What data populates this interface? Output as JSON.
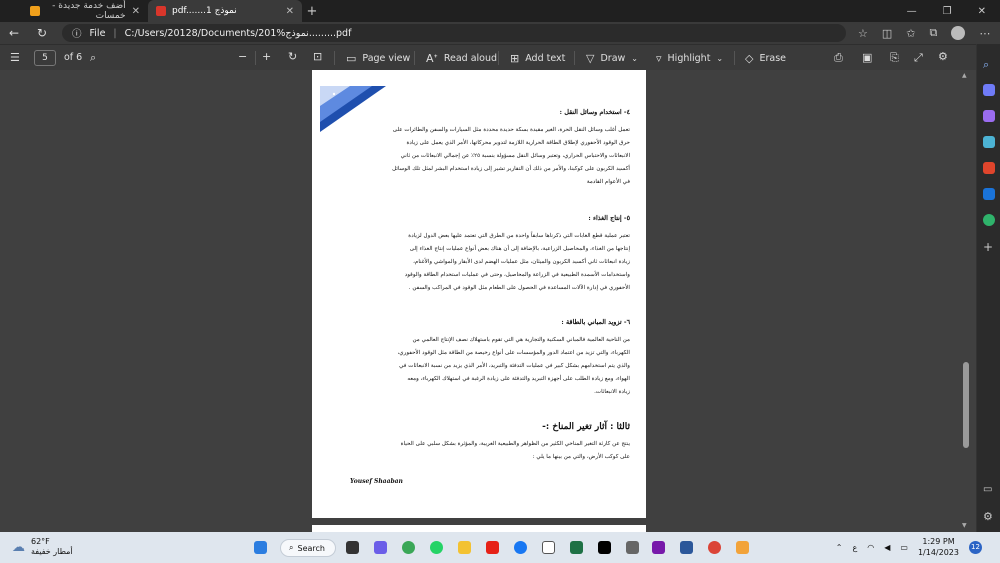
{
  "tabs": [
    {
      "title": "أضف خدمة جديدة - خمسات",
      "favicon_color": "#f0a01b"
    },
    {
      "title": "pdf.......نموذج 1",
      "favicon_color": "#d9362b"
    }
  ],
  "address": {
    "scheme_label": "File",
    "url": "C:/Users/20128/Documents/201%نموذج.........pdf"
  },
  "pdf_toolbar": {
    "page_number": "5",
    "page_total": "of 6",
    "page_view": "Page view",
    "read_aloud": "Read aloud",
    "add_text": "Add text",
    "draw": "Draw",
    "highlight": "Highlight",
    "erase": "Erase"
  },
  "document": {
    "h4": "٤- استخدام وسائل النقل :",
    "p4": [
      "تعمل أغلب وسائل النقل الحرة، الغير مقيدة بسكة حديدة محددة مثل السيارات والسفن والطائرات على",
      "حرق الوقود الأحفوري لإطلاق الطاقة الحرارية اللازمة لتدوير محركاتها، الأمر الذي يعمل على زيادة",
      "الانبعاثات والاحتباس الحراري، وتعتبر وسائل النقل مسؤولة بنسبة ٢٥٪ عن إجمالي الانبعاثات من ثاني",
      "أكسيد الكربون على كوكبنا، والأمر من ذلك أن التقارير تشير إلى زيادة استخدام البشر لمثل تلك الوسائل",
      "في الأعوام القادمة"
    ],
    "h5": "٥- إنتاج الغذاء :",
    "p5": [
      "تعتبر عملية قطع الغابات التي ذكرناها سابقاً واحدة من الطرق التي تعتمد عليها بعض الدول لزيادة",
      "إنتاجها من الغذاء، والمحاصيل الزراعية، بالإضافة إلى أن هناك بعض أنواع عمليات إنتاج الغذاء إلى",
      "زيادة انبعاثات ثاني أكسيد الكربون والميثان، مثل عمليات الهضم لدى الأبقار والمواشي والأغنام،",
      "واستخدامات الأسمدة الطبيعية في الزراعة والمحاصيل، وحتى في عمليات استخدام الطاقة والوقود",
      "الأحفوري في إدارة الآلات المساعدة في الحصول على الطعام مثل الوقود في المراكب والسفن ."
    ],
    "h6": "٦- تزويد المباني بالطاقة :",
    "p6": [
      "من الناحية العالمية فالمباني السكنية والتجارية هي التي تقوم باستهلاك نصف الإنتاج العالمي من",
      "الكهرباء، والتي تزيد من اعتماد الدور والمؤسسات على أنواع رخيصة من الطاقة مثل الوقود الأحفوري،",
      "والذي يتم استخدامهم بشكل كبير في عمليات التدفئة والتبريد، الأمر الذي يزيد من نسبة الانبعاثات في",
      "الهواء، ومع زيادة الطلب على أجهزة التبريد والتدفئة على زيادة الرغبة في استهلاك الكهرباء، ومعه",
      "زيادة الانبعاثات."
    ],
    "h3": "ثالثا : آثار تغير المناخ :-",
    "p7": [
      "ينتج عن كارثة التغير المناخي الكثير من الظواهر والطبيعية الغريبة، والمؤثرة بشكل سلبي على الحياة",
      "على كوكب الأرض، والتي من بينها ما يلي :"
    ],
    "signature": "Yousef Shaaban"
  },
  "taskbar": {
    "temp": "62°F",
    "weather_desc": "أمطار خفيفة",
    "search_label": "Search",
    "lang": "ع",
    "time": "1:29 PM",
    "date": "1/14/2023",
    "notifications": "12"
  },
  "colors": {
    "accent": "#2b64c5",
    "page_bg": "#ffffff",
    "viewer_bg": "#404040",
    "taskbar_bg": "#dfe6ee"
  }
}
